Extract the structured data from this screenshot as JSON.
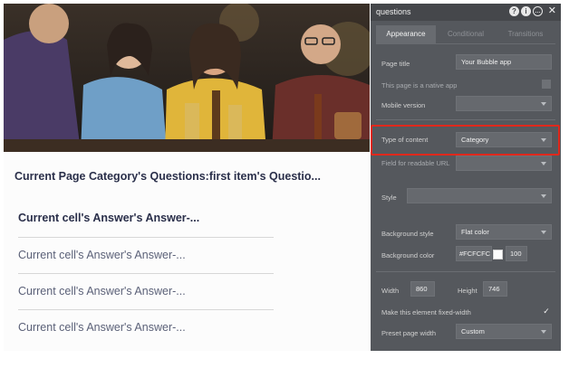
{
  "canvas": {
    "heading": "Current Page Category's Questions:first item's Questio...",
    "cells": [
      "Current cell's Answer's Answer-...",
      "Current cell's Answer's Answer-...",
      "Current cell's Answer's Answer-...",
      "Current cell's Answer's Answer-..."
    ]
  },
  "panel": {
    "title": "questions",
    "tabs": [
      "Appearance",
      "Conditional",
      "Transitions"
    ],
    "page_title_label": "Page title",
    "page_title_value": "Your Bubble app",
    "native_app_label": "This page is a native app",
    "mobile_version_label": "Mobile version",
    "type_of_content_label": "Type of content",
    "type_of_content_value": "Category",
    "readable_url_label": "Field for readable URL",
    "style_label": "Style",
    "bg_style_label": "Background style",
    "bg_style_value": "Flat color",
    "bg_color_label": "Background color",
    "bg_color_value": "#FCFCFC",
    "bg_opacity": "100",
    "width_label": "Width",
    "width_value": "860",
    "height_label": "Height",
    "height_value": "746",
    "fixed_width_label": "Make this element fixed-width",
    "preset_label": "Preset page width",
    "preset_value": "Custom"
  },
  "colors": {
    "panel_bg": "#55585d",
    "highlight": "#e0281c",
    "heading_text": "#2a2f4a"
  }
}
